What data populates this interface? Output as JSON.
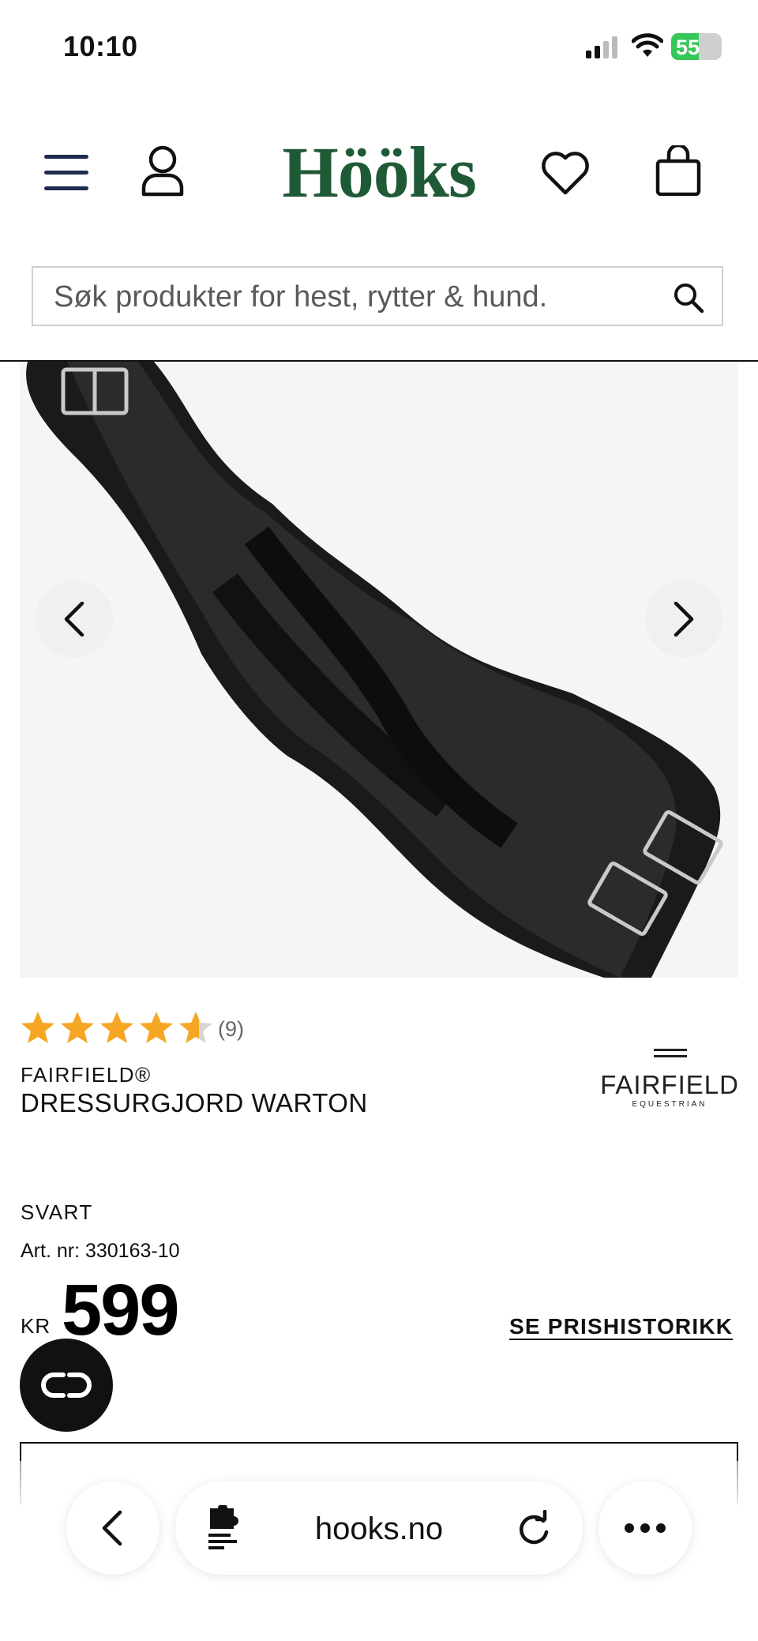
{
  "status_bar": {
    "time": "10:10",
    "battery": "55"
  },
  "header": {
    "logo": "Hööks"
  },
  "search": {
    "placeholder": "Søk produkter for hest, rytter & hund."
  },
  "product": {
    "rating": 4.5,
    "rating_count": "(9)",
    "brand": "FAIRFIELD®",
    "name": "DRESSURGJORD WARTON",
    "brand_logo": {
      "word": "FAIRFIELD",
      "sub": "EQUESTRIAN"
    },
    "color": "SVART",
    "article_number": "Art. nr: 330163-10",
    "currency": "KR",
    "price": "599",
    "price_history_link": "SE PRISHISTORIKK"
  },
  "browser": {
    "url": "hooks.no"
  },
  "colors": {
    "brand_green": "#1f5a36",
    "star": "#f5a623",
    "battery": "#34c759"
  }
}
